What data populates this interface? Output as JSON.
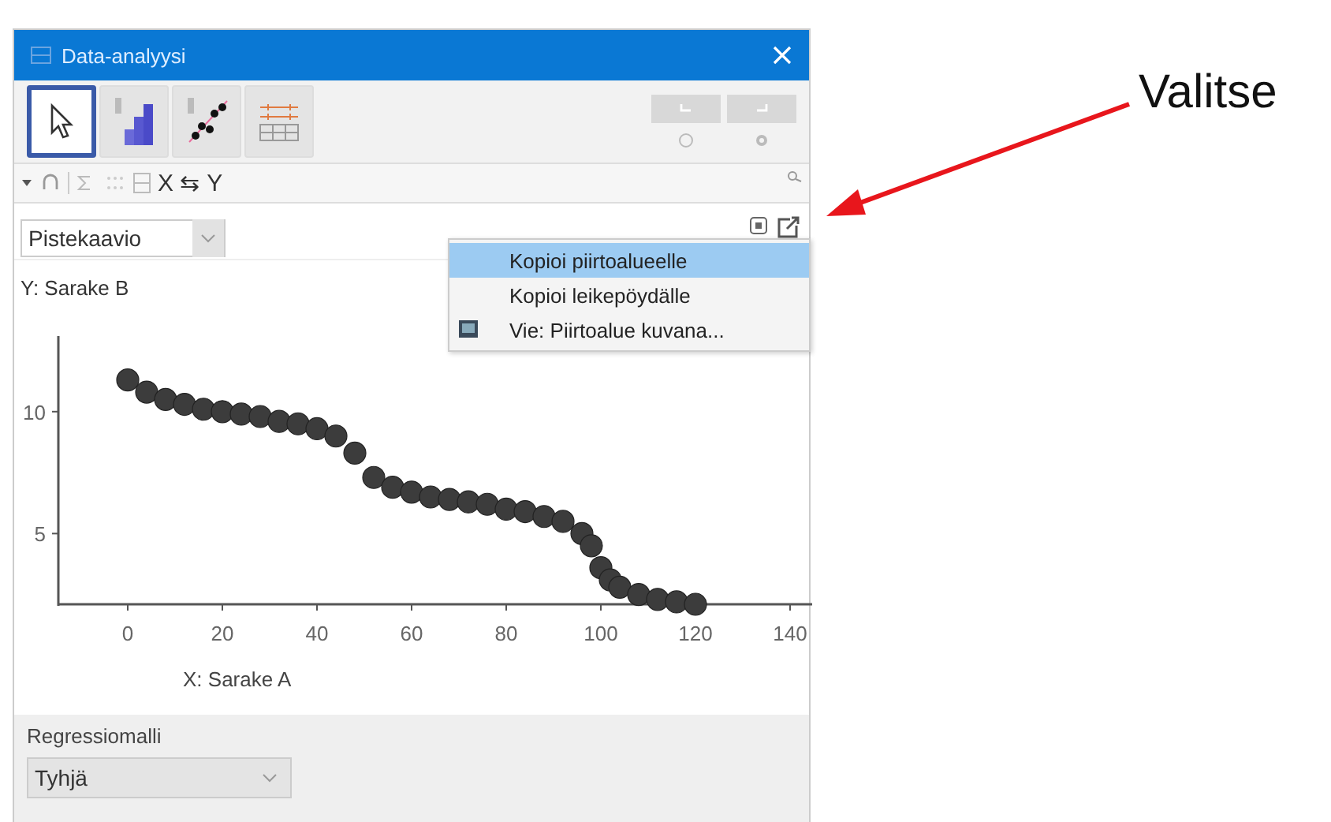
{
  "window": {
    "title": "Data-analyysi"
  },
  "toolbar": {
    "tools": [
      {
        "kind": "pointer",
        "selected": true
      },
      {
        "kind": "histogram",
        "selected": false
      },
      {
        "kind": "scatter",
        "selected": false
      },
      {
        "kind": "table",
        "selected": false
      }
    ],
    "undo_disabled": true,
    "redo_disabled": true
  },
  "secondary_toolbar": {
    "swap_label": "X ⇆ Y"
  },
  "plot_panel": {
    "plot_type": "Pistekaavio",
    "menu": [
      {
        "label": "Kopioi piirtoalueelle",
        "selected": true,
        "has_icon": false
      },
      {
        "label": "Kopioi leikepöydälle",
        "selected": false,
        "has_icon": false
      },
      {
        "label": "Vie: Piirtoalue kuvana...",
        "selected": false,
        "has_icon": true
      }
    ],
    "chart_data": {
      "type": "scatter",
      "ylabel": "Y:  Sarake B",
      "xlabel": "X:  Sarake A",
      "xlim": [
        -14.7,
        144.7
      ],
      "ylim": [
        2.1,
        13.1
      ],
      "xticks": [
        0,
        20,
        40,
        60,
        80,
        100,
        120,
        140
      ],
      "yticks": [
        5,
        10
      ],
      "x": [
        0,
        4,
        8,
        12,
        16,
        20,
        24,
        28,
        32,
        36,
        40,
        44,
        48,
        52,
        56,
        60,
        64,
        68,
        72,
        76,
        80,
        84,
        88,
        92,
        96,
        98,
        100,
        102,
        104,
        108,
        112,
        116,
        120
      ],
      "series": [
        {
          "color": "#3c3c3c",
          "values": [
            11.3,
            10.8,
            10.5,
            10.3,
            10.1,
            10.0,
            9.9,
            9.8,
            9.6,
            9.5,
            9.3,
            9.0,
            8.3,
            7.3,
            6.9,
            6.7,
            6.5,
            6.4,
            6.3,
            6.2,
            6.0,
            5.9,
            5.7,
            5.5,
            5.0,
            4.5,
            3.6,
            3.1,
            2.8,
            2.5,
            2.3,
            2.2,
            2.1
          ]
        }
      ]
    }
  },
  "regression": {
    "label": "Regressiomalli",
    "model": "Tyhjä"
  },
  "annotation": {
    "text": "Valitse"
  }
}
